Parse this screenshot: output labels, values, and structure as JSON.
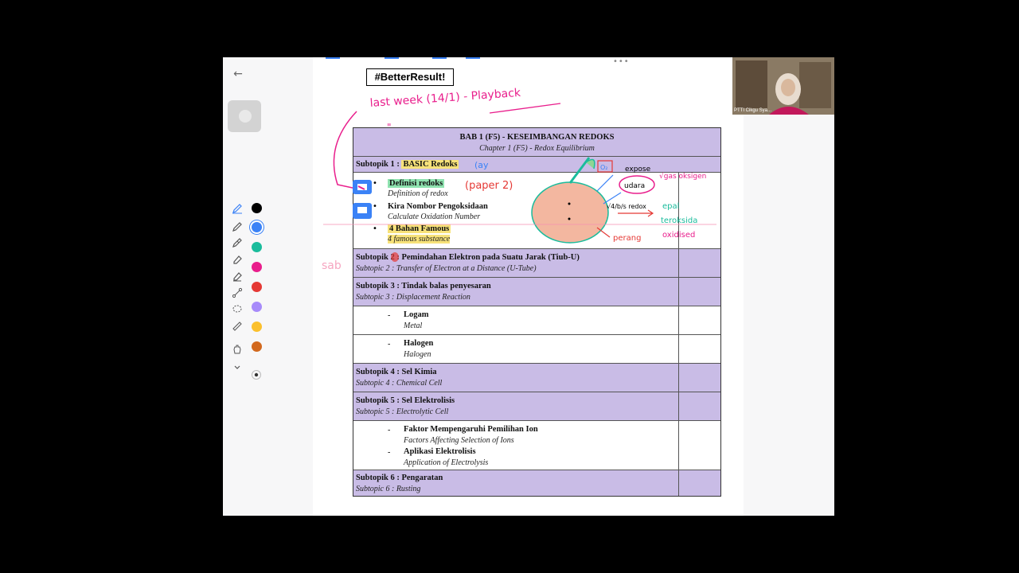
{
  "page_heading": "#BetterResult!",
  "toolbar": {
    "colors": [
      "#000000",
      "#3b82f6",
      "#1abc9c",
      "#e91e8c",
      "#e53935",
      "#a78bfa",
      "#fbc02d",
      "#d2691e"
    ],
    "selected_color": "#3b82f6"
  },
  "syllabus": {
    "chapter_ms": "BAB 1 (F5) - KESEIMBANGAN REDOKS",
    "chapter_en": "Chapter 1 (F5) - Redox Equilibrium",
    "subtopic1_label": "Subtopik 1 : ",
    "subtopic1_name": "BASIC Redoks",
    "s1_item1_ms": "Definisi redoks",
    "s1_item1_en": "Definition of redox",
    "s1_item2_ms": "Kira Nombor Pengoksidaan",
    "s1_item2_en": "Calculate Oxidation Number",
    "s1_item3_ms": "4 Bahan Famous",
    "s1_item3_en": "4 famous substance",
    "subtopic2_ms": "Subtopik 2 : Pemindahan Elektron pada Suatu Jarak (Tiub-U)",
    "subtopic2_en": "Subtopic 2 : Transfer of Electron at a Distance (U-Tube)",
    "subtopic3_ms": "Subtopik 3 : Tindak balas penyesaran",
    "subtopic3_en": "Subtopic 3 : Displacement Reaction",
    "s3_item1_ms": "Logam",
    "s3_item1_en": "Metal",
    "s3_item2_ms": "Halogen",
    "s3_item2_en": "Halogen",
    "subtopic4_ms": "Subtopik 4 : Sel Kimia",
    "subtopic4_en": "Subtopic 4 : Chemical Cell",
    "subtopic5_ms": "Subtopik 5 : Sel Elektrolisis",
    "subtopic5_en": "Subtopic 5 : Electrolytic Cell",
    "s5_item1_ms": "Faktor Mempengaruhi Pemilihan Ion",
    "s5_item1_en": "Factors Affecting Selection of Ions",
    "s5_item2_ms": "Aplikasi Elektrolisis",
    "s5_item2_en": "Application of Electrolysis",
    "subtopic6_ms": "Subtopik 6 : Pengaratan",
    "subtopic6_en": "Subtopic 6 : Rusting"
  },
  "annotations": {
    "last_week": "last week (14/1) - Playback",
    "ay": "(ay",
    "paper2": "(paper 2)",
    "o2": "O₂",
    "expose": "expose",
    "udara": "udara",
    "gas_oksigen": "√gas oksigen",
    "redox_note": "√4/b/s redox",
    "epal": "epal",
    "teroksida": "teroksida",
    "oxidised": "oxidised",
    "perang": "perang",
    "side_note": "sab"
  },
  "video": {
    "caption": "PTTI Cikgu Sya..."
  }
}
